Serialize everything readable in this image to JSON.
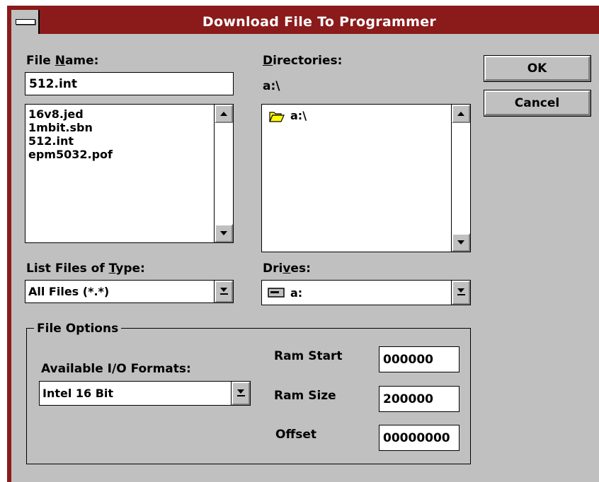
{
  "window": {
    "title": "Download File To Programmer"
  },
  "file_name": {
    "label_pre": "File ",
    "label_key": "N",
    "label_post": "ame:",
    "value": "512.int",
    "files": [
      "16v8.jed",
      "1mbit.sbn",
      "512.int",
      "epm5032.pof"
    ]
  },
  "directories": {
    "label_key": "D",
    "label_post": "irectories:",
    "current_path": "a:\\",
    "items": [
      "a:\\"
    ]
  },
  "file_type": {
    "label_pre": "List Files of ",
    "label_key": "T",
    "label_post": "ype:",
    "selected": "All Files (*.*)"
  },
  "drives": {
    "label_pre": "Dri",
    "label_key": "v",
    "label_post": "es:",
    "selected": "a:"
  },
  "buttons": {
    "ok": "OK",
    "cancel": "Cancel"
  },
  "file_options": {
    "title": "File Options",
    "formats_label": "Available I/O Formats:",
    "format_selected": "Intel 16 Bit",
    "ram_start_label": "Ram Start",
    "ram_start": "000000",
    "ram_size_label": "Ram Size",
    "ram_size": "200000",
    "offset_label": "Offset",
    "offset": "00000000"
  },
  "icons": {
    "system_menu": "system-menu-icon",
    "folder": "open-folder-icon",
    "drive": "floppy-drive-icon",
    "dropdown": "dropdown-arrow-icon",
    "scroll_up": "scroll-up-arrow-icon",
    "scroll_down": "scroll-down-arrow-icon"
  },
  "colors": {
    "titlebar": "#8b1a1a",
    "dialog": "#c0c0c0",
    "folder": "#ffff00"
  }
}
